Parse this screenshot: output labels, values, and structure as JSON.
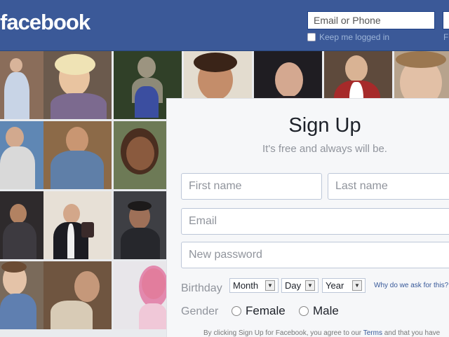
{
  "header": {
    "logo_text": "facebook",
    "email_placeholder": "Email or Phone",
    "keep_logged_in": "Keep me logged in",
    "forgot_stub": "F"
  },
  "signup": {
    "title": "Sign Up",
    "subtitle": "It's free and always will be.",
    "first_name_placeholder": "First name",
    "last_name_placeholder": "Last name",
    "email_placeholder": "Email",
    "password_placeholder": "New password",
    "birthday_label": "Birthday",
    "month": "Month",
    "day": "Day",
    "year": "Year",
    "why_link": "Why do we ask for this?",
    "gender_label": "Gender",
    "female": "Female",
    "male": "Male",
    "terms_prefix": "By clicking Sign Up for Facebook, you agree to our ",
    "terms_link": "Terms",
    "terms_suffix": " and that you have"
  },
  "colors": {
    "brand": "#3b5998",
    "link": "#365899"
  }
}
